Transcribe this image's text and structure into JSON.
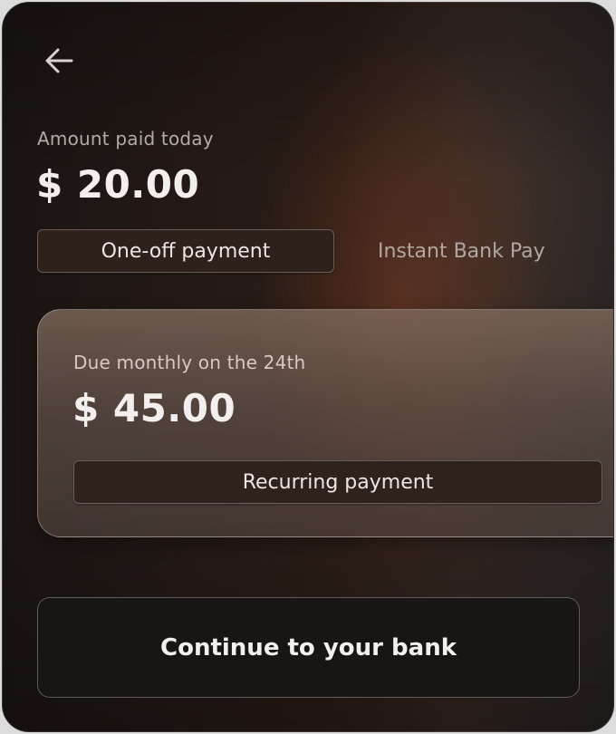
{
  "header": {
    "back_icon": "arrow-left-icon"
  },
  "today": {
    "label": "Amount paid today",
    "amount": "$ 20.00"
  },
  "tabs": [
    {
      "label": "One-off payment",
      "selected": true
    },
    {
      "label": "Instant Bank Pay",
      "selected": false
    }
  ],
  "recurring": {
    "label": "Due monthly on the 24th",
    "amount": "$ 45.00",
    "chip_label": "Recurring payment"
  },
  "cta": {
    "label": "Continue to your bank"
  },
  "colors": {
    "background": "#1f1714",
    "chip_fill": "#2e201b",
    "card_glass": "#7a6860",
    "cta_fill": "#181615",
    "text_primary": "#f2efee",
    "text_muted": "#b5aba6"
  }
}
